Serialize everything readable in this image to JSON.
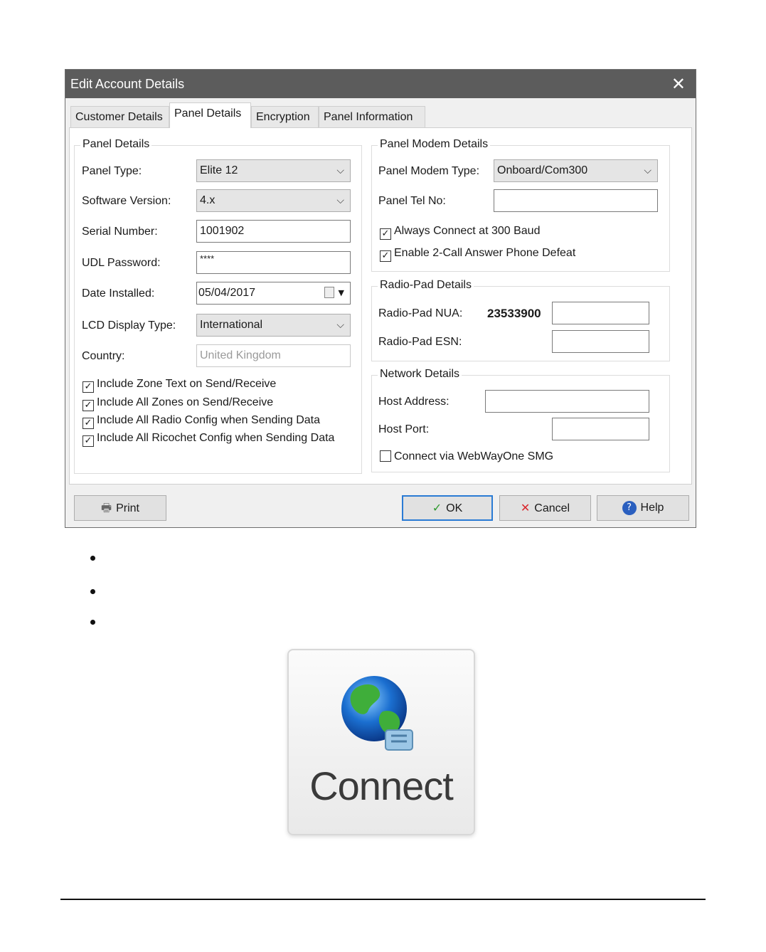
{
  "dialog": {
    "title": "Edit Account Details",
    "tabs": [
      "Customer Details",
      "Panel Details",
      "Encryption",
      "Panel Information"
    ],
    "active_tab": "Panel Details",
    "panel_details": {
      "legend": "Panel Details",
      "panel_type_label": "Panel Type:",
      "panel_type_value": "Elite 12",
      "software_version_label": "Software Version:",
      "software_version_value": "4.x",
      "serial_number_label": "Serial Number:",
      "serial_number_value": "1001902",
      "udl_password_label": "UDL Password:",
      "udl_password_value": "****",
      "date_installed_label": "Date Installed:",
      "date_installed_value": "05/04/2017",
      "lcd_display_label": "LCD Display Type:",
      "lcd_display_value": "International",
      "country_label": "Country:",
      "country_value": "United Kingdom",
      "checkboxes": [
        {
          "label": "Include Zone Text on Send/Receive",
          "checked": true
        },
        {
          "label": "Include All Zones on Send/Receive",
          "checked": true
        },
        {
          "label": "Include All Radio Config when Sending Data",
          "checked": true
        },
        {
          "label": "Include All Ricochet Config when Sending Data",
          "checked": true
        }
      ]
    },
    "modem": {
      "legend": "Panel Modem Details",
      "modem_type_label": "Panel Modem Type:",
      "modem_type_value": "Onboard/Com300",
      "tel_label": "Panel Tel No:",
      "tel_value": "",
      "always_300": {
        "label": "Always Connect at 300 Baud",
        "checked": true
      },
      "two_call": {
        "label": "Enable 2-Call Answer Phone Defeat",
        "checked": true
      }
    },
    "radiopad": {
      "legend": "Radio-Pad Details",
      "nua_label": "Radio-Pad NUA:",
      "nua_prefix": "23533900",
      "nua_value": "",
      "esn_label": "Radio-Pad ESN:",
      "esn_value": ""
    },
    "network": {
      "legend": "Network Details",
      "host_address_label": "Host Address:",
      "host_address_value": "",
      "host_port_label": "Host Port:",
      "host_port_value": "",
      "webwayone": {
        "label": "Connect via WebWayOne SMG",
        "checked": false
      }
    },
    "buttons": {
      "print": "Print",
      "ok": "OK",
      "cancel": "Cancel",
      "help": "Help"
    }
  },
  "connect_button": {
    "label": "Connect",
    "icon": "globe-network-icon"
  },
  "colors": {
    "titlebar": "#5c5c5c",
    "ok_border": "#2a7bd4",
    "cancel_x": "#d9262c",
    "check_green": "#2e9a2e"
  }
}
